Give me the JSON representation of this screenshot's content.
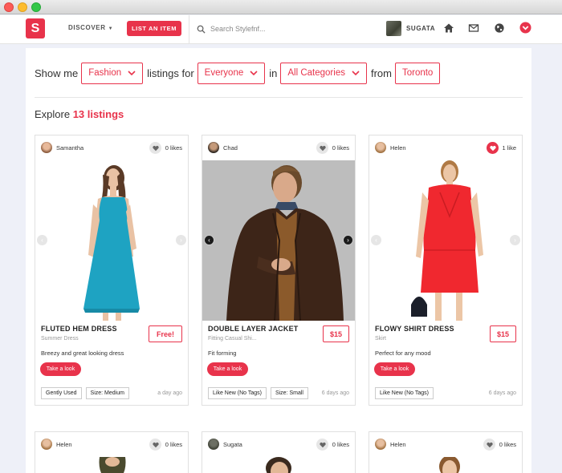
{
  "nav": {
    "logo": "S",
    "discover_label": "DISCOVER",
    "list_item_label": "LIST AN ITEM",
    "search_placeholder": "Search Stylefnf...",
    "username": "SUGATA",
    "accent": "#e8334b"
  },
  "filters": {
    "show_me": "Show me",
    "category": "Fashion",
    "listings_for": "listings for",
    "audience": "Everyone",
    "in": "in",
    "subcategory": "All Categories",
    "from": "from",
    "city": "Toronto"
  },
  "explore": {
    "prefix": "Explore",
    "count_label": "13 listings"
  },
  "listings": [
    {
      "user": "Samantha",
      "likes": "0 likes",
      "liked": false,
      "title": "FLUTED HEM DRESS",
      "subtitle": "Summer Dress",
      "description": "Breezy and great looking dress",
      "price": "Free!",
      "cta": "Take a look",
      "tags": [
        "Gently Used",
        "Size: Medium"
      ],
      "age": "a day ago",
      "image": "woman-teal-dress"
    },
    {
      "user": "Chad",
      "likes": "0 likes",
      "liked": false,
      "title": "DOUBLE LAYER JACKET",
      "subtitle": "Fitting Casual Shi...",
      "description": "Fit forming",
      "price": "$15",
      "cta": "Take a look",
      "tags": [
        "Like New (No Tags)",
        "Size: Small"
      ],
      "age": "6 days ago",
      "image": "man-leather-jacket"
    },
    {
      "user": "Helen",
      "likes": "1 like",
      "liked": true,
      "title": "FLOWY SHIRT DRESS",
      "subtitle": "Skirt",
      "description": "Perfect for any mood",
      "price": "$15",
      "cta": "Take a look",
      "tags": [
        "Like New (No Tags)"
      ],
      "age": "6 days ago",
      "image": "woman-red-dress"
    },
    {
      "user": "Helen",
      "likes": "0 likes",
      "liked": false
    },
    {
      "user": "Sugata",
      "likes": "0 likes",
      "liked": false
    },
    {
      "user": "Helen",
      "likes": "0 likes",
      "liked": false
    }
  ]
}
